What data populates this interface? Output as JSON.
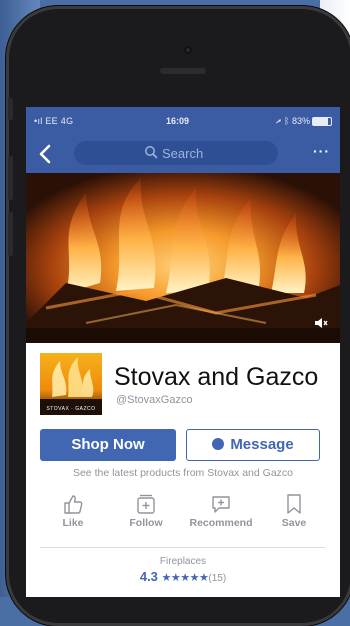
{
  "status_bar": {
    "carrier": "EE 4G",
    "time": "16:09",
    "battery": "83%",
    "battery_level": 0.83
  },
  "nav": {
    "search_placeholder": "Search",
    "more_label": "···"
  },
  "page": {
    "name": "Stovax and Gazco",
    "handle": "@StovaxGazco",
    "tagline": "See the latest products from Stovax and Gazco"
  },
  "buttons": {
    "shop_now": "Shop Now",
    "message": "Message"
  },
  "actions": [
    {
      "label": "Like",
      "icon": "thumbs-up-icon"
    },
    {
      "label": "Follow",
      "icon": "follow-icon"
    },
    {
      "label": "Recommend",
      "icon": "recommend-icon"
    },
    {
      "label": "Save",
      "icon": "bookmark-icon"
    }
  ],
  "rating": {
    "category": "Fireplaces",
    "value": "4.3",
    "stars": "★★★★★",
    "count": "(15)"
  },
  "colors": {
    "facebook_blue": "#3b5ba3",
    "button_blue": "#4267b2"
  }
}
